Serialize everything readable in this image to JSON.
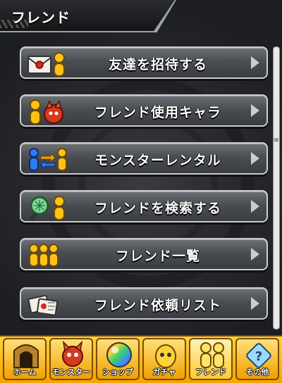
{
  "header": {
    "title": "フレンド"
  },
  "menu": {
    "items": [
      {
        "label": "友達を招待する",
        "icon": "invite-letter-icon"
      },
      {
        "label": "フレンド使用キャラ",
        "icon": "friend-monster-icon"
      },
      {
        "label": "モンスターレンタル",
        "icon": "swap-arrows-icon"
      },
      {
        "label": "フレンドを検索する",
        "icon": "magnifier-icon"
      },
      {
        "label": "フレンド一覧",
        "icon": "friends-group-icon"
      },
      {
        "label": "フレンド依頼リスト",
        "icon": "requests-cards-icon"
      }
    ]
  },
  "tabs": [
    {
      "label": "ホーム",
      "icon": "home-door-icon",
      "active": false
    },
    {
      "label": "モンスター",
      "icon": "dragon-icon",
      "active": false
    },
    {
      "label": "ショップ",
      "icon": "rainbow-orb-icon",
      "active": false
    },
    {
      "label": "ガチャ",
      "icon": "gacha-egg-icon",
      "active": false
    },
    {
      "label": "フレンド",
      "icon": "friends-icon",
      "active": true
    },
    {
      "label": "その他",
      "icon": "other-question-icon",
      "active": false
    }
  ],
  "colors": {
    "accent": "#f5a400",
    "button": "#4a4d52",
    "person_yellow": "#ffc21a",
    "person_blue": "#2f7bf0"
  }
}
